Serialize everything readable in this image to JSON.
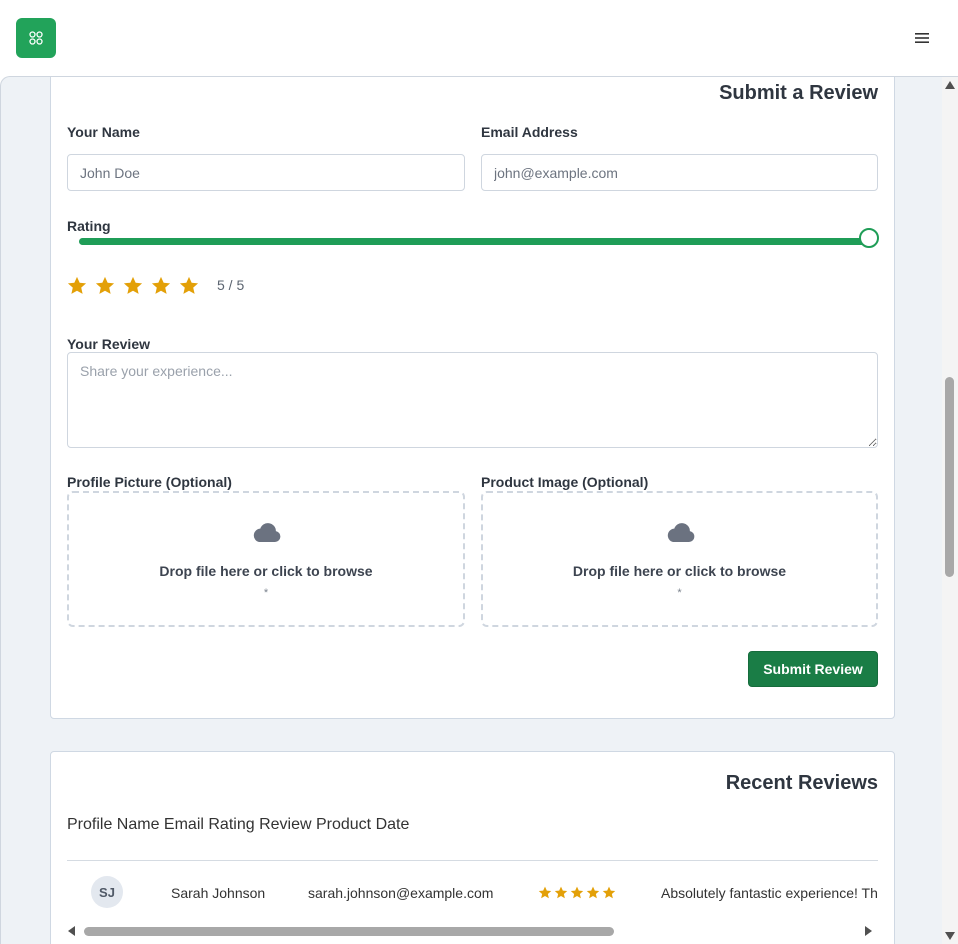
{
  "header": {
    "logo_icon": "grid-app-icon",
    "menu_icon": "hamburger-menu-icon",
    "brand_color": "#22a35a"
  },
  "review_form": {
    "title": "Submit a Review",
    "name_label": "Your Name",
    "name_placeholder": "John Doe",
    "email_label": "Email Address",
    "email_placeholder": "john@example.com",
    "rating_label": "Rating",
    "rating_value": 5,
    "rating_max": 5,
    "rating_text": "5 / 5",
    "review_label": "Your Review",
    "review_placeholder": "Share your experience...",
    "profile_pic_label": "Profile Picture (Optional)",
    "product_image_label": "Product Image (Optional)",
    "dropzone_text": "Drop file here or click to browse",
    "dropzone_hint": "*",
    "upload_icon": "cloud-icon",
    "submit_label": "Submit Review",
    "accent_color": "#1f9d57",
    "star_color": "#e3a008"
  },
  "recent_reviews": {
    "title": "Recent Reviews",
    "columns_text": "Profile Name Email Rating Review Product Date",
    "rows": [
      {
        "initials": "SJ",
        "name": "Sarah Johnson",
        "email": "sarah.johnson@example.com",
        "rating": 5,
        "review": "Absolutely fantastic experience! The"
      }
    ]
  }
}
